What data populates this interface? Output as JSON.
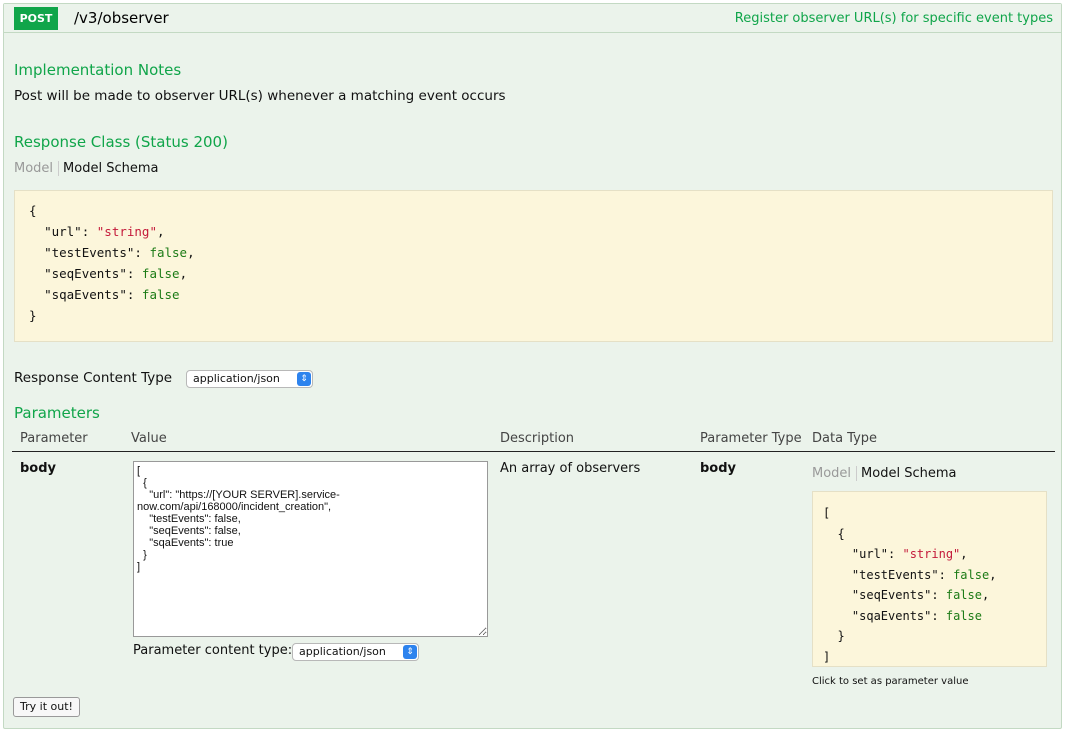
{
  "operation": {
    "method": "POST",
    "path": "/v3/observer",
    "summary": "Register observer URL(s) for specific event types"
  },
  "implementation_notes": {
    "heading": "Implementation Notes",
    "text": "Post will be made to observer URL(s) whenever a matching event occurs"
  },
  "response_class": {
    "heading": "Response Class (Status 200)",
    "tab_model": "Model",
    "tab_schema": "Model Schema",
    "schema": {
      "open": "{",
      "lines": [
        {
          "key": "\"url\"",
          "value": "\"string\"",
          "type": "string",
          "comma": ","
        },
        {
          "key": "\"testEvents\"",
          "value": "false",
          "type": "bool",
          "comma": ","
        },
        {
          "key": "\"seqEvents\"",
          "value": "false",
          "type": "bool",
          "comma": ","
        },
        {
          "key": "\"sqaEvents\"",
          "value": "false",
          "type": "bool",
          "comma": ""
        }
      ],
      "close": "}"
    }
  },
  "response_content_type": {
    "label": "Response Content Type",
    "selected": "application/json"
  },
  "parameters": {
    "heading": "Parameters",
    "columns": [
      "Parameter",
      "Value",
      "Description",
      "Parameter Type",
      "Data Type"
    ],
    "rows": [
      {
        "name": "body",
        "value": "[\n  {\n    \"url\": \"https://[YOUR SERVER].service-\nnow.com/api/168000/incident_creation\",\n    \"testEvents\": false,\n    \"seqEvents\": false,\n    \"sqaEvents\": true\n  }\n]",
        "description": "An array of observers",
        "param_type": "body",
        "content_type_label": "Parameter content type:",
        "content_type_selected": "application/json",
        "datatype_tab_model": "Model",
        "datatype_tab_schema": "Model Schema",
        "schema": {
          "open": "[",
          "inner_open": "{",
          "lines": [
            {
              "key": "\"url\"",
              "value": "\"string\"",
              "type": "string",
              "comma": ","
            },
            {
              "key": "\"testEvents\"",
              "value": "false",
              "type": "bool",
              "comma": ","
            },
            {
              "key": "\"seqEvents\"",
              "value": "false",
              "type": "bool",
              "comma": ","
            },
            {
              "key": "\"sqaEvents\"",
              "value": "false",
              "type": "bool",
              "comma": ""
            }
          ],
          "inner_close": "}",
          "close": "]"
        },
        "hint": "Click to set as parameter value"
      }
    ]
  },
  "try_button": "Try it out!",
  "colors": {
    "accent": "#10a54a",
    "panel_bg": "#ebf3eb",
    "snippet_bg": "#fcf6db",
    "string": "#c41a3a",
    "boolean": "#1c7b16",
    "select_caret": "#2d83ee"
  },
  "icons": {
    "select_caret": "updown-chevron-icon"
  }
}
